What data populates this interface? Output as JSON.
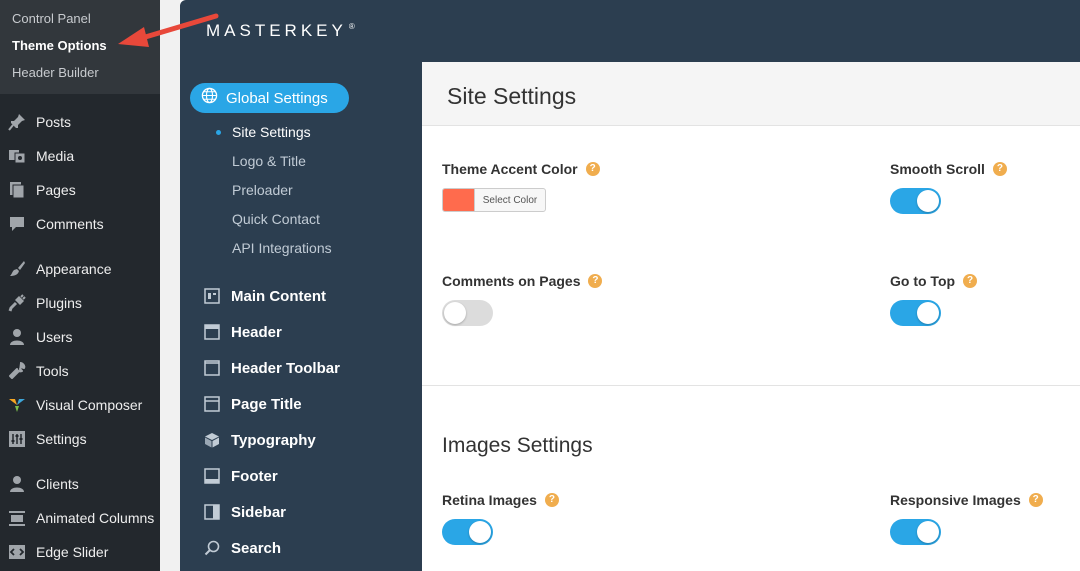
{
  "wp_admin": {
    "submenu": [
      {
        "label": "Control Panel",
        "current": false
      },
      {
        "label": "Theme Options",
        "current": true
      },
      {
        "label": "Header Builder",
        "current": false
      }
    ],
    "menu": [
      {
        "label": "Posts",
        "icon": "pin-icon"
      },
      {
        "label": "Media",
        "icon": "media-icon"
      },
      {
        "label": "Pages",
        "icon": "pages-icon"
      },
      {
        "label": "Comments",
        "icon": "comment-icon"
      },
      {
        "label": "Appearance",
        "icon": "brush-icon"
      },
      {
        "label": "Plugins",
        "icon": "plug-icon"
      },
      {
        "label": "Users",
        "icon": "user-icon"
      },
      {
        "label": "Tools",
        "icon": "wrench-icon"
      },
      {
        "label": "Visual Composer",
        "icon": "visual-composer-icon"
      },
      {
        "label": "Settings",
        "icon": "settings-sliders-icon"
      },
      {
        "label": "Clients",
        "icon": "clients-icon"
      },
      {
        "label": "Animated Columns",
        "icon": "columns-icon"
      },
      {
        "label": "Edge Slider",
        "icon": "slider-icon"
      }
    ]
  },
  "theme": {
    "brand": "MASTERKEY",
    "brand_mark": "®",
    "nav": {
      "global": {
        "label": "Global Settings",
        "icon": "globe-icon"
      },
      "sub": [
        {
          "label": "Site Settings",
          "active": true
        },
        {
          "label": "Logo & Title",
          "active": false
        },
        {
          "label": "Preloader",
          "active": false
        },
        {
          "label": "Quick Contact",
          "active": false
        },
        {
          "label": "API Integrations",
          "active": false
        }
      ],
      "items": [
        {
          "label": "Main Content",
          "icon": "layout-icon"
        },
        {
          "label": "Header",
          "icon": "header-icon"
        },
        {
          "label": "Header Toolbar",
          "icon": "toolbar-icon"
        },
        {
          "label": "Page Title",
          "icon": "page-title-icon"
        },
        {
          "label": "Typography",
          "icon": "cube-icon"
        },
        {
          "label": "Footer",
          "icon": "footer-icon"
        },
        {
          "label": "Sidebar",
          "icon": "sidebar-icon"
        },
        {
          "label": "Search",
          "icon": "search-icon"
        }
      ]
    },
    "content": {
      "title": "Site Settings",
      "help_glyph": "?",
      "fields": {
        "accent_color": {
          "label": "Theme Accent Color",
          "button": "Select Color",
          "value": "#ff6b4d"
        },
        "smooth_scroll": {
          "label": "Smooth Scroll",
          "on": true
        },
        "comments_pages": {
          "label": "Comments on Pages",
          "on": false
        },
        "go_to_top": {
          "label": "Go to Top",
          "on": true
        }
      },
      "images_title": "Images Settings",
      "images_fields": {
        "retina": {
          "label": "Retina Images",
          "on": true
        },
        "responsive": {
          "label": "Responsive Images",
          "on": true
        }
      }
    }
  },
  "colors": {
    "accent": "#2aa6e6",
    "panel": "#2c3e50",
    "help": "#f0ad4e",
    "arrow": "#e8483a"
  }
}
